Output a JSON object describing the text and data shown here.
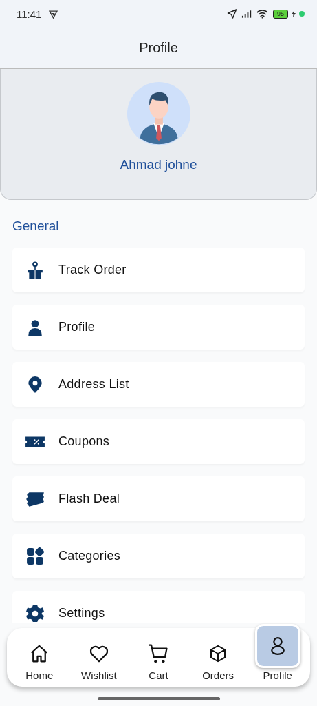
{
  "status_bar": {
    "time": "11:41",
    "battery": "95"
  },
  "header": {
    "title": "Profile"
  },
  "profile": {
    "name": "Ahmad johne"
  },
  "section": {
    "title": "General"
  },
  "menu": [
    {
      "label": "Track Order"
    },
    {
      "label": "Profile"
    },
    {
      "label": "Address List"
    },
    {
      "label": "Coupons"
    },
    {
      "label": "Flash Deal"
    },
    {
      "label": "Categories"
    },
    {
      "label": "Settings"
    }
  ],
  "nav": [
    {
      "label": "Home",
      "selected": false
    },
    {
      "label": "Wishlist",
      "selected": false
    },
    {
      "label": "Cart",
      "selected": false
    },
    {
      "label": "Orders",
      "selected": false
    },
    {
      "label": "Profile",
      "selected": true
    }
  ]
}
